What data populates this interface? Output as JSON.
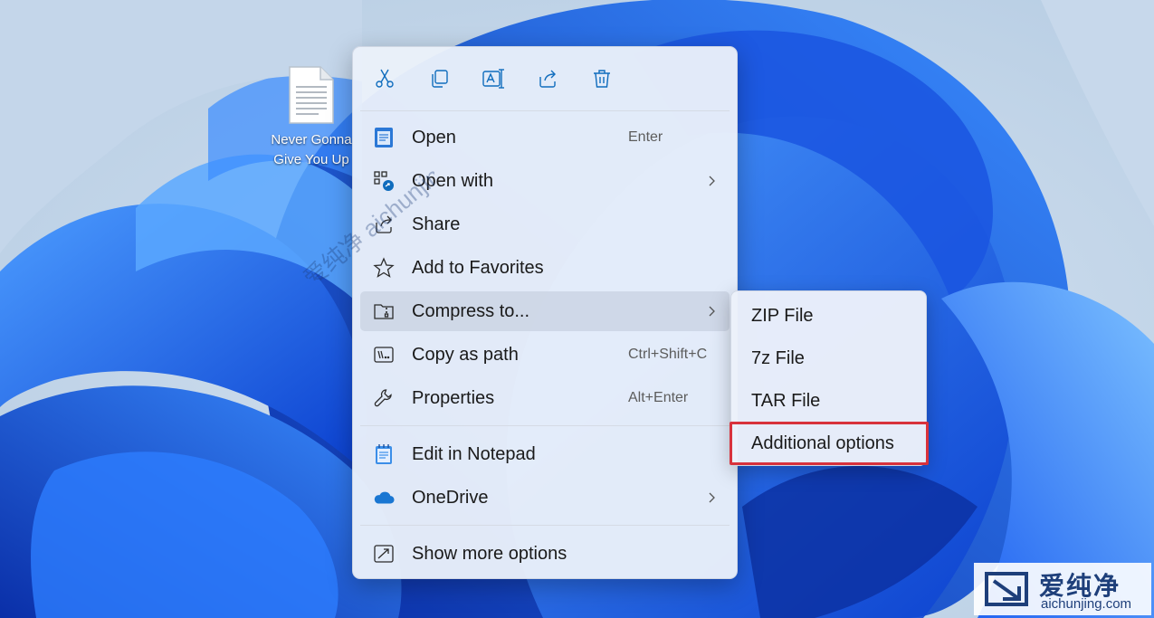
{
  "desktop": {
    "file": {
      "name_line1": "Never Gonna",
      "name_line2": "Give You Up",
      "icon": "text-file-icon"
    }
  },
  "context_menu": {
    "toolbar": [
      {
        "action": "Cut",
        "icon": "scissors-icon"
      },
      {
        "action": "Copy",
        "icon": "copy-icon"
      },
      {
        "action": "Rename",
        "icon": "rename-icon"
      },
      {
        "action": "Share",
        "icon": "share-icon"
      },
      {
        "action": "Delete",
        "icon": "trash-icon"
      }
    ],
    "items": [
      {
        "label": "Open",
        "shortcut": "Enter",
        "icon": "notepad-icon"
      },
      {
        "label": "Open with",
        "shortcut": "",
        "icon": "open-with-icon",
        "submenu": true
      },
      {
        "label": "Share",
        "shortcut": "",
        "icon": "share-icon"
      },
      {
        "label": "Add to Favorites",
        "shortcut": "",
        "icon": "star-icon"
      },
      {
        "label": "Compress to...",
        "shortcut": "",
        "icon": "zip-folder-icon",
        "submenu": true,
        "highlighted": true
      },
      {
        "label": "Copy as path",
        "shortcut": "Ctrl+Shift+C",
        "icon": "copy-path-icon"
      },
      {
        "label": "Properties",
        "shortcut": "Alt+Enter",
        "icon": "wrench-icon"
      },
      {
        "label": "Edit in Notepad",
        "shortcut": "",
        "icon": "notepad-app-icon"
      },
      {
        "label": "OneDrive",
        "shortcut": "",
        "icon": "cloud-icon",
        "submenu": true
      },
      {
        "label": "Show more options",
        "shortcut": "",
        "icon": "more-options-icon"
      }
    ]
  },
  "compress_submenu": {
    "items": [
      {
        "label": "ZIP File"
      },
      {
        "label": "7z File"
      },
      {
        "label": "TAR File"
      },
      {
        "label": "Additional options",
        "outlined": true
      }
    ],
    "outline_color": "#d8323c"
  },
  "watermark": {
    "title": "爱纯净",
    "url": "aichunjing.com",
    "diagonal_text": "爱纯净 aichunjing.com"
  },
  "colors": {
    "accent": "#0f6cbd",
    "menu_bg": "#eaf0fa",
    "highlight": "#d8323c"
  }
}
